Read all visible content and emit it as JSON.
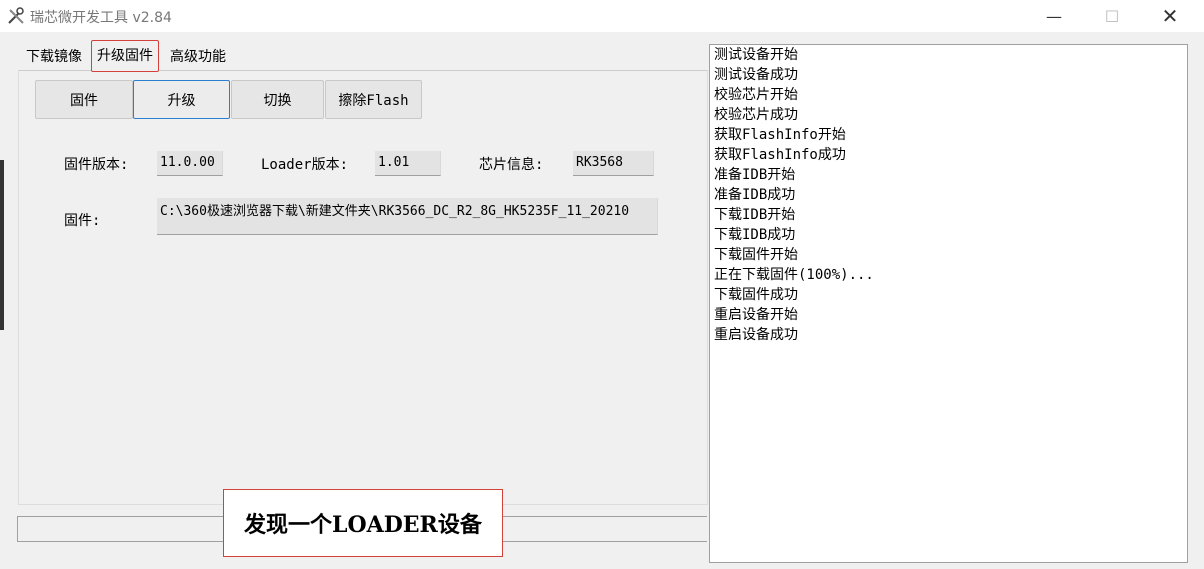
{
  "window": {
    "title": "瑞芯微开发工具 v2.84",
    "controls": {
      "minimize": "—",
      "maximize": "☐",
      "close": "✕"
    }
  },
  "tabs": [
    {
      "label": "下载镜像"
    },
    {
      "label": "升级固件"
    },
    {
      "label": "高级功能"
    }
  ],
  "buttons": {
    "firmware": "固件",
    "upgrade": "升级",
    "switch": "切换",
    "erase_flash": "擦除Flash"
  },
  "info": {
    "firmware_version_label": "固件版本:",
    "firmware_version": "11.0.00",
    "loader_version_label": "Loader版本:",
    "loader_version": "1.01",
    "chip_info_label": "芯片信息:",
    "chip_info": "RK3568",
    "firmware_path_label": "固件:",
    "firmware_path": "C:\\360极速浏览器下载\\新建文件夹\\RK3566_DC_R2_8G_HK5235F_11_20210"
  },
  "log": [
    "测试设备开始",
    "测试设备成功",
    "校验芯片开始",
    "校验芯片成功",
    "获取FlashInfo开始",
    "获取FlashInfo成功",
    "准备IDB开始",
    "准备IDB成功",
    "下载IDB开始",
    "下载IDB成功",
    "下载固件开始",
    "正在下载固件(100%)...",
    "下载固件成功",
    "重启设备开始",
    "重启设备成功"
  ],
  "status": {
    "message": "发现一个LOADER设备"
  },
  "colors": {
    "highlight_border": "#d4403a",
    "focus_border": "#2a7fd1"
  }
}
